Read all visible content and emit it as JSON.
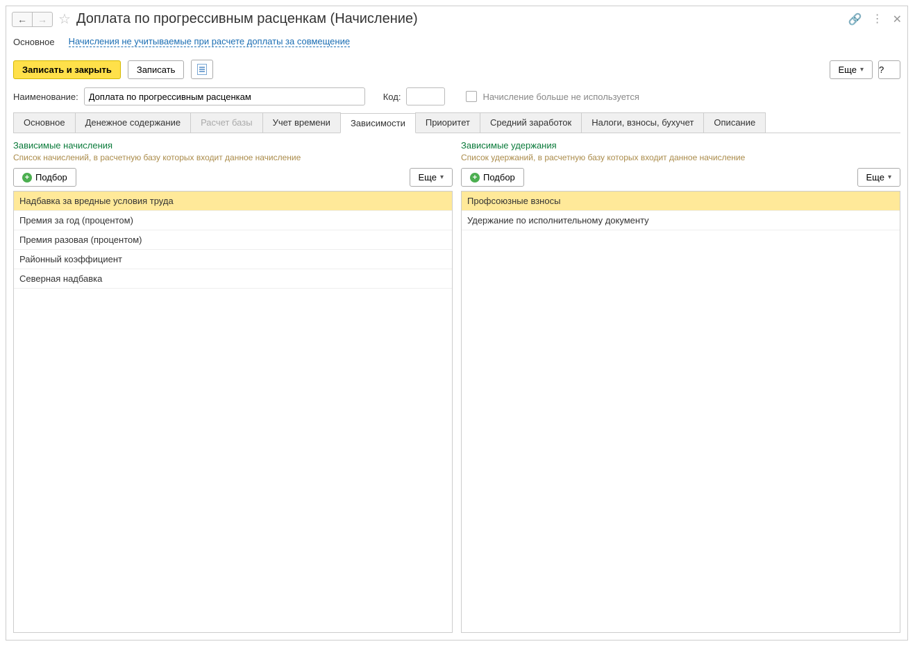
{
  "title": "Доплата по прогрессивным расценкам (Начисление)",
  "navLinks": {
    "main": "Основное",
    "excluded": "Начисления не учитываемые при расчете доплаты за совмещение"
  },
  "toolbar": {
    "saveClose": "Записать и закрыть",
    "save": "Записать",
    "more": "Еще",
    "help": "?"
  },
  "form": {
    "nameLabel": "Наименование:",
    "nameValue": "Доплата по прогрессивным расценкам",
    "codeLabel": "Код:",
    "codeValue": "",
    "noLongerUsed": "Начисление больше не используется"
  },
  "tabs": [
    {
      "label": "Основное",
      "active": false,
      "disabled": false
    },
    {
      "label": "Денежное содержание",
      "active": false,
      "disabled": false
    },
    {
      "label": "Расчет базы",
      "active": false,
      "disabled": true
    },
    {
      "label": "Учет времени",
      "active": false,
      "disabled": false
    },
    {
      "label": "Зависимости",
      "active": true,
      "disabled": false
    },
    {
      "label": "Приоритет",
      "active": false,
      "disabled": false
    },
    {
      "label": "Средний заработок",
      "active": false,
      "disabled": false
    },
    {
      "label": "Налоги, взносы, бухучет",
      "active": false,
      "disabled": false
    },
    {
      "label": "Описание",
      "active": false,
      "disabled": false
    }
  ],
  "leftPanel": {
    "title": "Зависимые начисления",
    "desc": "Список начислений, в расчетную базу которых входит данное начисление",
    "pick": "Подбор",
    "more": "Еще",
    "items": [
      {
        "label": "Надбавка за вредные условия труда",
        "selected": true
      },
      {
        "label": "Премия за год (процентом)",
        "selected": false
      },
      {
        "label": "Премия разовая (процентом)",
        "selected": false
      },
      {
        "label": "Районный коэффициент",
        "selected": false
      },
      {
        "label": "Северная надбавка",
        "selected": false
      }
    ]
  },
  "rightPanel": {
    "title": "Зависимые удержания",
    "desc": "Список удержаний, в расчетную базу которых входит данное начисление",
    "pick": "Подбор",
    "more": "Еще",
    "items": [
      {
        "label": "Профсоюзные взносы",
        "selected": true
      },
      {
        "label": "Удержание по исполнительному документу",
        "selected": false
      }
    ]
  }
}
